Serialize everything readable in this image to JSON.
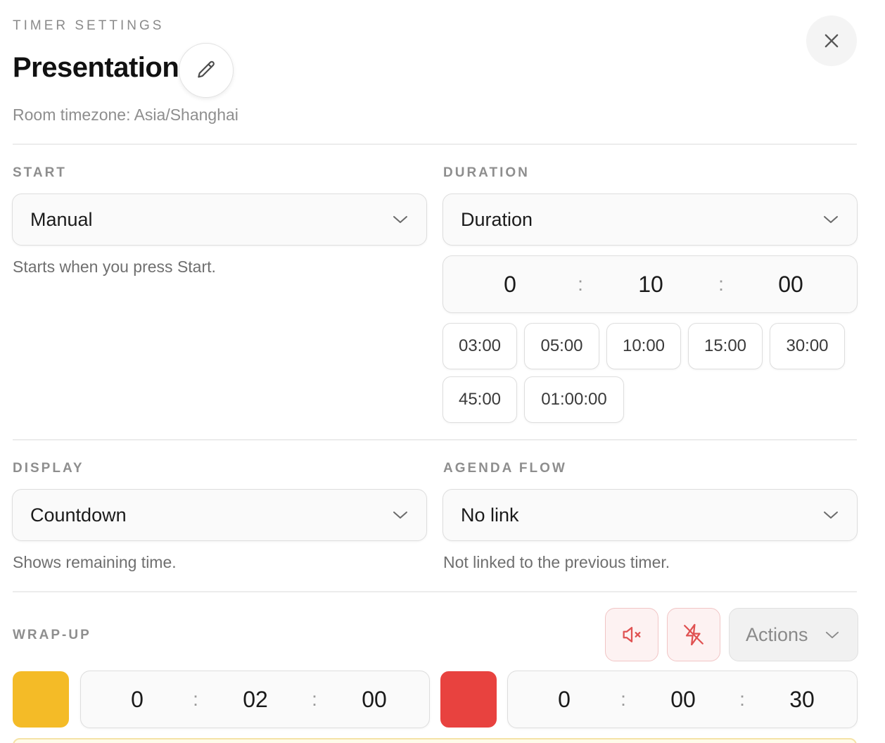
{
  "header": {
    "eyebrow": "TIMER SETTINGS",
    "title": "Presentation",
    "subtitle": "Room timezone: Asia/Shanghai",
    "edit_icon": "pencil-icon",
    "close_icon": "close-icon"
  },
  "start": {
    "label": "START",
    "value": "Manual",
    "hint": "Starts when you press Start."
  },
  "duration": {
    "label": "DURATION",
    "value": "Duration",
    "time": {
      "hours": "0",
      "minutes": "10",
      "seconds": "00",
      "separator": ":"
    },
    "presets": [
      "03:00",
      "05:00",
      "10:00",
      "15:00",
      "30:00",
      "45:00",
      "01:00:00"
    ]
  },
  "display": {
    "label": "DISPLAY",
    "value": "Countdown",
    "hint": "Shows remaining time."
  },
  "agenda_flow": {
    "label": "AGENDA FLOW",
    "value": "No link",
    "hint": "Not linked to the previous timer."
  },
  "wrapup": {
    "label": "WRAP-UP",
    "mute_icon": "speaker-mute-icon",
    "flash_off_icon": "flash-off-icon",
    "actions_label": "Actions",
    "yellow": {
      "color": "#f4bb27",
      "hours": "0",
      "minutes": "02",
      "seconds": "00"
    },
    "red": {
      "color": "#e8423f",
      "hours": "0",
      "minutes": "00",
      "seconds": "30"
    },
    "separator": ":"
  }
}
